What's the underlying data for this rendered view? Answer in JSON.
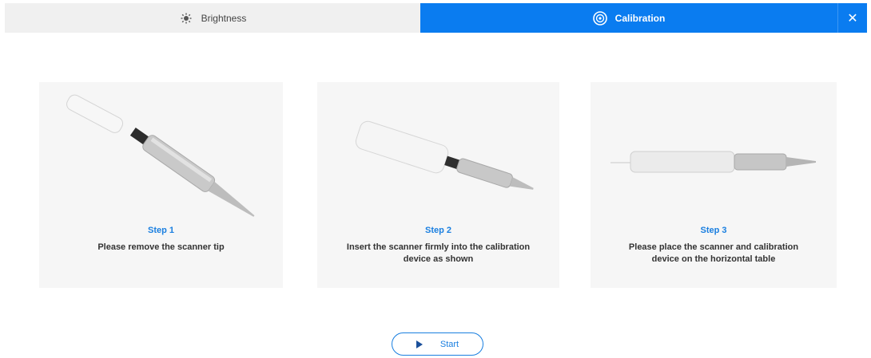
{
  "tabs": [
    {
      "label": "Brightness",
      "icon": "brightness-icon",
      "active": false
    },
    {
      "label": "Calibration",
      "icon": "calibration-icon",
      "active": true
    }
  ],
  "close_label": "✕",
  "steps": [
    {
      "title": "Step 1",
      "desc": "Please remove the scanner tip"
    },
    {
      "title": "Step 2",
      "desc": "Insert the scanner firmly into the calibration device as shown"
    },
    {
      "title": "Step 3",
      "desc": "Please place the scanner and calibration device on the horizontal table"
    }
  ],
  "start_label": "Start",
  "colors": {
    "accent": "#0a7cf0",
    "step_title": "#1a7fe0"
  }
}
